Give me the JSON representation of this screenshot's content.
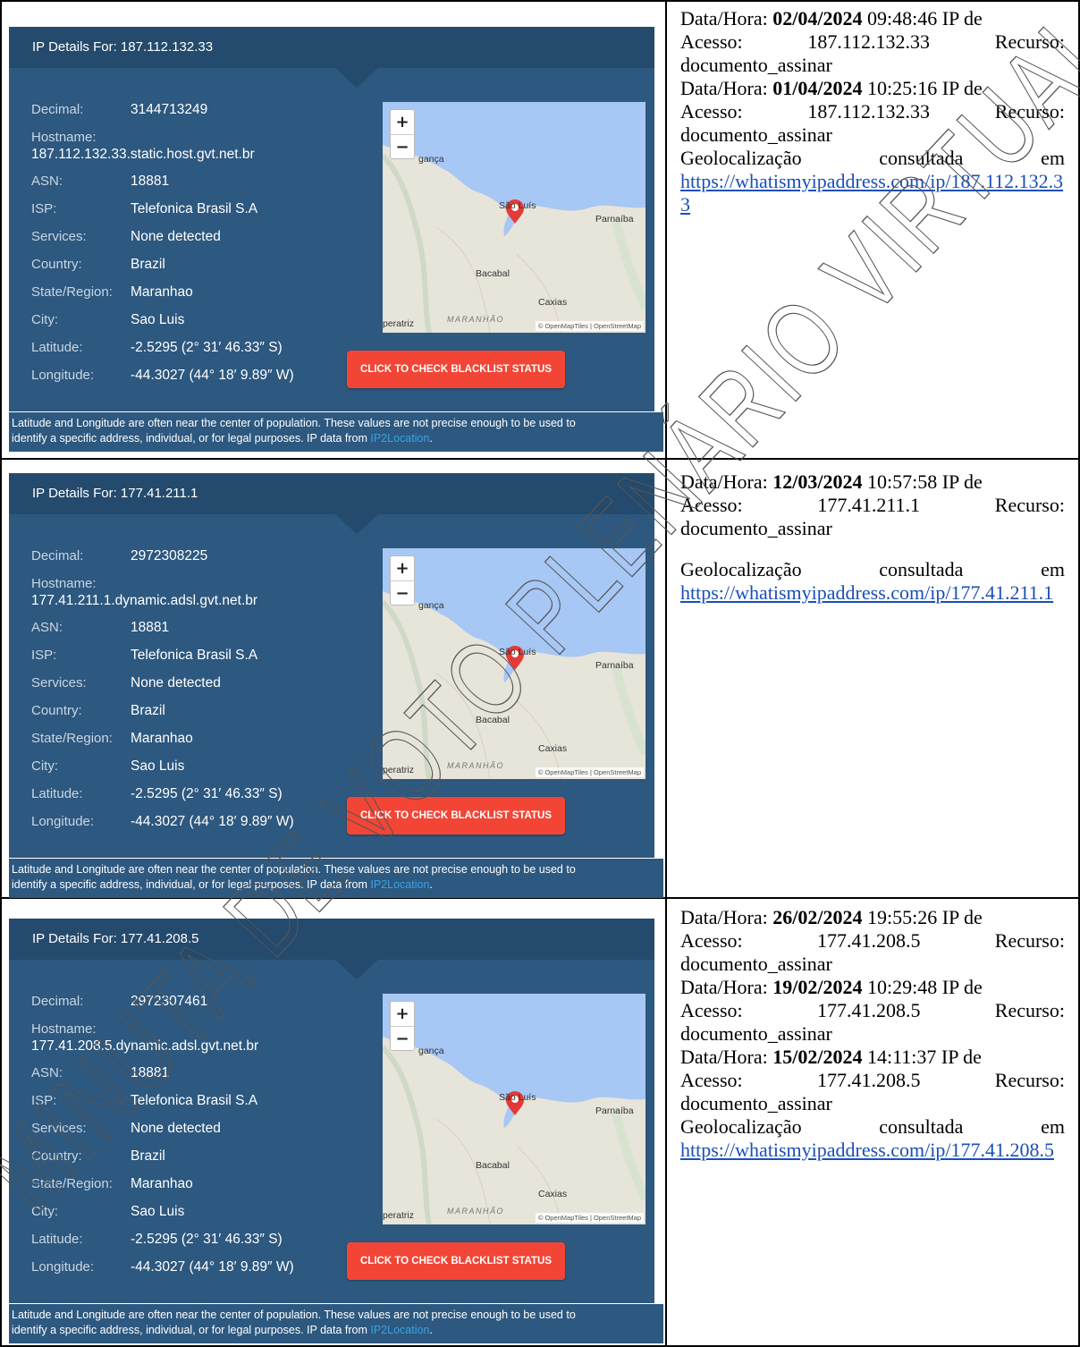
{
  "rows": [
    {
      "panel": {
        "header": "IP Details For: 187.112.132.33",
        "decimal_label": "Decimal:",
        "decimal": "3144713249",
        "hostname_label": "Hostname:",
        "hostname": "187.112.132.33.static.host.gvt.net.br",
        "asn_label": "ASN:",
        "asn": "18881",
        "isp_label": "ISP:",
        "isp": "Telefonica Brasil S.A",
        "services_label": "Services:",
        "services": "None detected",
        "country_label": "Country:",
        "country": "Brazil",
        "state_label": "State/Region:",
        "state": "Maranhao",
        "city_label": "City:",
        "city": "Sao Luis",
        "lat_label": "Latitude:",
        "lat": "-2.5295  (2° 31′ 46.33″ S)",
        "lon_label": "Longitude:",
        "lon": "-44.3027  (44° 18′ 9.89″ W)",
        "button": "CLICK TO CHECK BLACKLIST STATUS",
        "note_1": "Latitude and Longitude are often near the center of population. These values are not precise enough to be used to",
        "note_2": "identify a specific address, individual, or for legal purposes. IP data from ",
        "note_link": "IP2Location",
        "note_end": "."
      },
      "entries": [
        {
          "l1a": "Data/Hora: ",
          "date": "02/04/2024",
          "l1b": " 09:48:46 IP de",
          "l2a": "Acesso:",
          "l2b": "187.112.132.33",
          "l2c": "Recurso:",
          "l3": "documento_assinar"
        },
        {
          "l1a": "Data/Hora: ",
          "date": "01/04/2024",
          "l1b": " 10:25:16 IP de",
          "l2a": "Acesso:",
          "l2b": "187.112.132.33",
          "l2c": "Recurso:",
          "l3": "documento_assinar"
        }
      ],
      "geo_a": "Geolocalização",
      "geo_b": "consultada",
      "geo_c": "em",
      "link": "https://whatismyipaddress.com/ip/187.112.132.33"
    },
    {
      "panel": {
        "header": "IP Details For: 177.41.211.1",
        "decimal_label": "Decimal:",
        "decimal": "2972308225",
        "hostname_label": "Hostname:",
        "hostname": "177.41.211.1.dynamic.adsl.gvt.net.br",
        "asn_label": "ASN:",
        "asn": "18881",
        "isp_label": "ISP:",
        "isp": "Telefonica Brasil S.A",
        "services_label": "Services:",
        "services": "None detected",
        "country_label": "Country:",
        "country": "Brazil",
        "state_label": "State/Region:",
        "state": "Maranhao",
        "city_label": "City:",
        "city": "Sao Luis",
        "lat_label": "Latitude:",
        "lat": "-2.5295  (2° 31′ 46.33″ S)",
        "lon_label": "Longitude:",
        "lon": "-44.3027  (44° 18′ 9.89″ W)",
        "button": "CLICK TO CHECK BLACKLIST STATUS",
        "note_1": "Latitude and Longitude are often near the center of population. These values are not precise enough to be used to",
        "note_2": "identify a specific address, individual, or for legal purposes. IP data from ",
        "note_link": "IP2Location",
        "note_end": "."
      },
      "entries": [
        {
          "l1a": "Data/Hora: ",
          "date": "12/03/2024",
          "l1b": " 10:57:58 IP de",
          "l2a": "Acesso:",
          "l2b": "177.41.211.1",
          "l2c": "Recurso:",
          "l3": "documento_assinar"
        }
      ],
      "geo_a": "Geolocalização",
      "geo_b": "consultada",
      "geo_c": "em",
      "link": "https://whatismyipaddress.com/ip/177.41.211.1"
    },
    {
      "panel": {
        "header": "IP Details For: 177.41.208.5",
        "decimal_label": "Decimal:",
        "decimal": "2972307461",
        "hostname_label": "Hostname:",
        "hostname": "177.41.208.5.dynamic.adsl.gvt.net.br",
        "asn_label": "ASN:",
        "asn": "18881",
        "isp_label": "ISP:",
        "isp": "Telefonica Brasil S.A",
        "services_label": "Services:",
        "services": "None detected",
        "country_label": "Country:",
        "country": "Brazil",
        "state_label": "State/Region:",
        "state": "Maranhao",
        "city_label": "City:",
        "city": "Sao Luis",
        "lat_label": "Latitude:",
        "lat": "-2.5295  (2° 31′ 46.33″ S)",
        "lon_label": "Longitude:",
        "lon": "-44.3027  (44° 18′ 9.89″ W)",
        "button": "CLICK TO CHECK BLACKLIST STATUS",
        "note_1": "Latitude and Longitude are often near the center of population. These values are not precise enough to be used to",
        "note_2": "identify a specific address, individual, or for legal purposes. IP data from ",
        "note_link": "IP2Location",
        "note_end": "."
      },
      "entries": [
        {
          "l1a": "Data/Hora: ",
          "date": "26/02/2024",
          "l1b": " 19:55:26 IP de",
          "l2a": "Acesso:",
          "l2b": "177.41.208.5",
          "l2c": "Recurso:",
          "l3": "documento_assinar"
        },
        {
          "l1a": "Data/Hora: ",
          "date": "19/02/2024",
          "l1b": " 10:29:48 IP de",
          "l2a": "Acesso:",
          "l2b": "177.41.208.5",
          "l2c": "Recurso:",
          "l3": "documento_assinar"
        },
        {
          "l1a": "Data/Hora: ",
          "date": "15/02/2024",
          "l1b": " 14:11:37 IP de",
          "l2a": "Acesso:",
          "l2b": "177.41.208.5",
          "l2c": "Recurso:",
          "l3": "documento_assinar"
        }
      ],
      "geo_a": "Geolocalização",
      "geo_b": "consultada",
      "geo_c": "em",
      "link": "https://whatismyipaddress.com/ip/177.41.208.5"
    }
  ],
  "map": {
    "zoom_in": "+",
    "zoom_out": "−",
    "city_label": "São Luís",
    "parnaiba": "Parnaíba",
    "bacabal": "Bacabal",
    "caxias": "Caxias",
    "braganca": "gança",
    "imperatriz": "peratriz",
    "state": "MARANHÃO",
    "attribution": "© OpenMapTiles | OpenStreetMap"
  },
  "watermark": "MINUTA DE VOTO PLENÁRIO VIRTUAL",
  "colors": {
    "panel_bg": "#2d587f",
    "panel_header": "#244a6d",
    "button": "#f24536",
    "sea": "#a7c7f5",
    "land": "#e7e4d9",
    "link": "#1a4fb8"
  }
}
